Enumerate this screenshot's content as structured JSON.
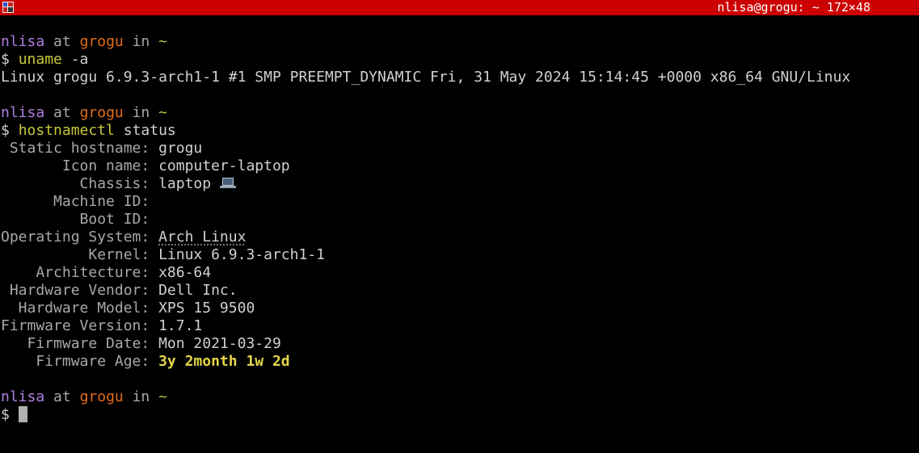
{
  "window": {
    "title": "nlisa@grogu: ~ 172×48"
  },
  "prompt": {
    "user": "nlisa",
    "at": "at",
    "host": "grogu",
    "in": "in",
    "path": "~",
    "symbol": "$"
  },
  "commands": [
    {
      "name": "uname",
      "args": "-a"
    },
    {
      "name": "hostnamectl",
      "args": "status"
    }
  ],
  "uname_output": "Linux grogu 6.9.3-arch1-1 #1 SMP PREEMPT_DYNAMIC Fri, 31 May 2024 15:14:45 +0000 x86_64 GNU/Linux",
  "hostnamectl": {
    "fields": [
      {
        "label": " Static hostname:",
        "value": "grogu"
      },
      {
        "label": "       Icon name:",
        "value": "computer-laptop"
      },
      {
        "label": "         Chassis:",
        "value": "laptop",
        "icon": "laptop-icon"
      },
      {
        "label": "      Machine ID:",
        "value": ""
      },
      {
        "label": "         Boot ID:",
        "value": ""
      },
      {
        "label": "Operating System:",
        "value": "Arch Linux"
      },
      {
        "label": "          Kernel:",
        "value": "Linux 6.9.3-arch1-1"
      },
      {
        "label": "    Architecture:",
        "value": "x86-64"
      },
      {
        "label": " Hardware Vendor:",
        "value": "Dell Inc."
      },
      {
        "label": "  Hardware Model:",
        "value": "XPS 15 9500"
      },
      {
        "label": "Firmware Version:",
        "value": "1.7.1"
      },
      {
        "label": "   Firmware Date:",
        "value": "Mon 2021-03-29"
      },
      {
        "label": "    Firmware Age:",
        "value": "3y 2month 1w 2d"
      }
    ]
  },
  "colors": {
    "titlebar": "#cc0000",
    "user": "#b07fe0",
    "host": "#e06c1a",
    "path": "#a6c94a",
    "command": "#c8c83c",
    "firmware_age": "#e5d64a"
  }
}
